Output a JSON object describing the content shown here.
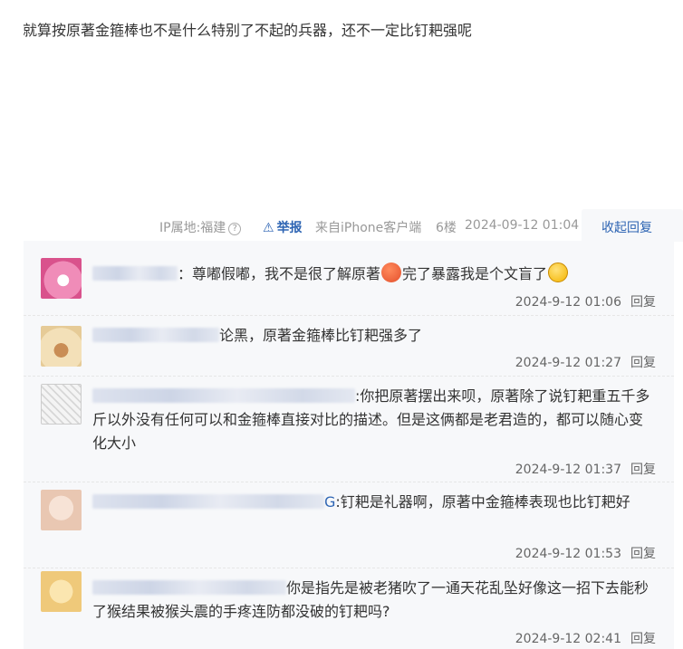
{
  "post": {
    "content": "就算按原著金箍棒也不是什么特别了不起的兵器，还不一定比钉耙强呢",
    "ip_location": "IP属地:福建",
    "help_icon": "?",
    "report_label": "举报",
    "device": "来自iPhone客户端",
    "floor": "6楼",
    "datetime": "2024-09-12 01:04",
    "collapse_label": "收起回复"
  },
  "replies": [
    {
      "username_tail": "：",
      "text_before": "尊嘟假嘟，我不是很了解原著",
      "text_after": "完了暴露我是个文盲了",
      "time": "2024-9-12 01:06",
      "reply_label": "回复",
      "avatar_color": "#e86aa0"
    },
    {
      "username_tail": "",
      "text": "论黑，原著金箍棒比钉耙强多了",
      "time": "2024-9-12 01:27",
      "reply_label": "回复",
      "avatar_color": "#e8c58a"
    },
    {
      "username_tail": "",
      "text": ":你把原著摆出来呗，原著除了说钉耙重五千多斤以外没有任何可以和金箍棒直接对比的描述。但是这俩都是老君造的，都可以随心变化大小",
      "time": "2024-9-12 01:37",
      "reply_label": "回复",
      "avatar_color": "#bdbdbd"
    },
    {
      "username_tail": "G",
      "text": ":钉耙是礼器啊，原著中金箍棒表现也比钉耙好",
      "time": "2024-9-12 01:53",
      "reply_label": "回复",
      "avatar_color": "#ead2c2"
    },
    {
      "username_tail": "",
      "text": "你是指先是被老猪吹了一通天花乱坠好像这一招下去能秒了猴结果被猴头震的手疼连防都没破的钉耙吗?",
      "time": "2024-9-12 02:41",
      "reply_label": "回复",
      "avatar_color": "#f2d08a"
    }
  ],
  "colors": {
    "link": "#2d64b3",
    "panel_bg": "#f7f8fa",
    "meta": "#999999"
  }
}
